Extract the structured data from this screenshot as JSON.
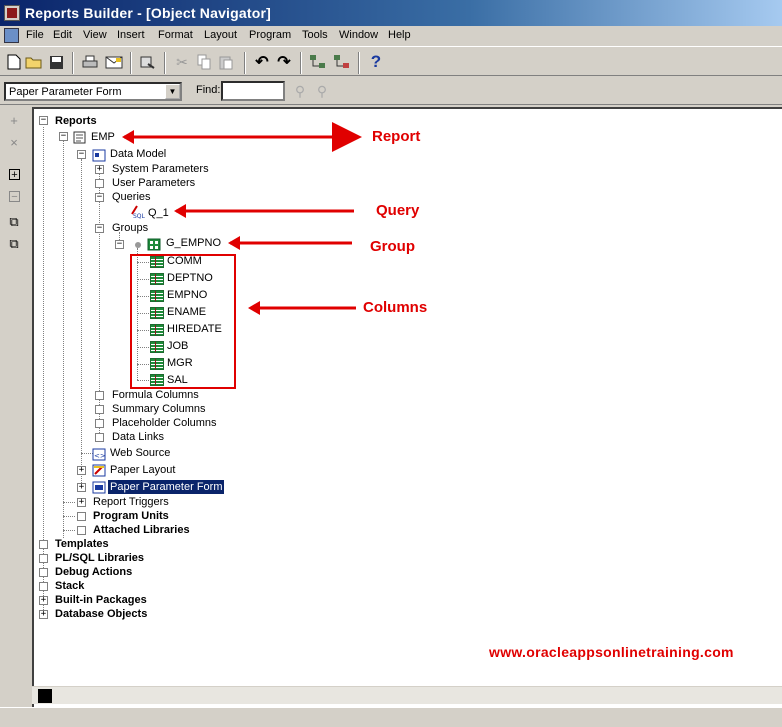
{
  "window": {
    "title": "Reports Builder - [Object Navigator]"
  },
  "menu": [
    "File",
    "Edit",
    "View",
    "Insert",
    "Format",
    "Layout",
    "Program",
    "Tools",
    "Window",
    "Help"
  ],
  "findbar": {
    "selected_view": "Paper Parameter Form",
    "find_label": "Find:",
    "find_value": ""
  },
  "tree": {
    "reports": "Reports",
    "emp": "EMP",
    "data_model": "Data Model",
    "system_parameters": "System Parameters",
    "user_parameters": "User Parameters",
    "queries": "Queries",
    "q1": "Q_1",
    "groups": "Groups",
    "g_empno": "G_EMPNO",
    "columns": [
      "COMM",
      "DEPTNO",
      "EMPNO",
      "ENAME",
      "HIREDATE",
      "JOB",
      "MGR",
      "SAL"
    ],
    "formula_columns": "Formula Columns",
    "summary_columns": "Summary Columns",
    "placeholder_columns": "Placeholder Columns",
    "data_links": "Data Links",
    "web_source": "Web Source",
    "paper_layout": "Paper Layout",
    "paper_parameter_form": "Paper Parameter Form",
    "report_triggers": "Report Triggers",
    "program_units": "Program Units",
    "attached_libraries": "Attached Libraries",
    "templates": "Templates",
    "plsql_libraries": "PL/SQL Libraries",
    "debug_actions": "Debug Actions",
    "stack": "Stack",
    "builtin_packages": "Built-in Packages",
    "database_objects": "Database Objects"
  },
  "annotations": {
    "report": "Report",
    "query": "Query",
    "group": "Group",
    "columns": "Columns",
    "watermark": "www.oracleappsonlinetraining.com"
  },
  "colors": {
    "annotation": "#e00000",
    "titlebar": "#0a246a",
    "selection": "#0a246a"
  }
}
